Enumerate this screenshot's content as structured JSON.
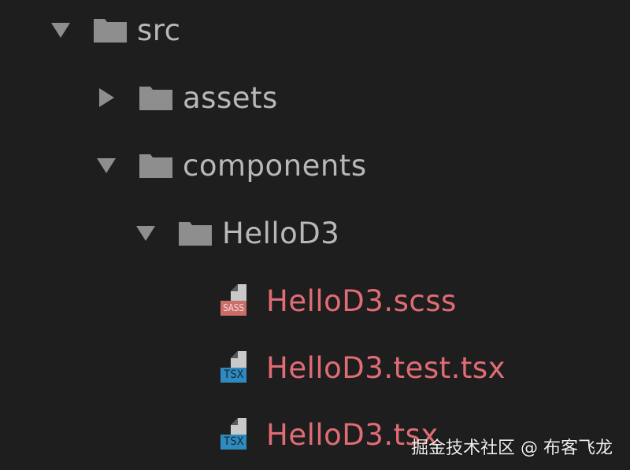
{
  "colors": {
    "background": "#1e1e1e",
    "folder_text": "#b8b8b8",
    "file_text_modified": "#e06c75",
    "icon_gray": "#8e8e8e",
    "sass_badge": "#cb6e6a",
    "tsx_badge": "#2f8bbf"
  },
  "tree": {
    "src": {
      "label": "src",
      "expanded": true,
      "icon": "folder-icon",
      "twisty": "chevron-down-icon"
    },
    "assets": {
      "label": "assets",
      "expanded": false,
      "icon": "folder-icon",
      "twisty": "chevron-right-icon"
    },
    "components": {
      "label": "components",
      "expanded": true,
      "icon": "folder-icon",
      "twisty": "chevron-down-icon"
    },
    "hellod3": {
      "label": "HelloD3",
      "expanded": true,
      "icon": "folder-icon",
      "twisty": "chevron-down-icon"
    },
    "files": [
      {
        "label": "HelloD3.scss",
        "badge": "SASS",
        "icon": "sass-file-icon"
      },
      {
        "label": "HelloD3.test.tsx",
        "badge": "TSX",
        "icon": "tsx-file-icon"
      },
      {
        "label": "HelloD3.tsx",
        "badge": "TSX",
        "icon": "tsx-file-icon"
      }
    ]
  },
  "watermark": "掘金技术社区 @ 布客飞龙"
}
